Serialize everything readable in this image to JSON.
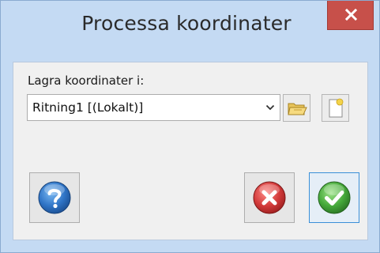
{
  "window": {
    "title": "Processa koordinater"
  },
  "form": {
    "label": "Lagra koordinater i:",
    "select_value": "Ritning1 [(Lokalt)]"
  },
  "icons": {
    "close": "close-icon",
    "dropdown": "chevron-down-icon",
    "open": "folder-icon",
    "new": "new-document-icon",
    "help": "help-icon",
    "cancel": "cancel-icon",
    "ok": "checkmark-icon"
  },
  "colors": {
    "close_button": "#c7504a",
    "help_blue": "#2f74c6",
    "cancel_red": "#d23a3a",
    "ok_green": "#45a93a",
    "focus_border": "#3a8fd8"
  }
}
